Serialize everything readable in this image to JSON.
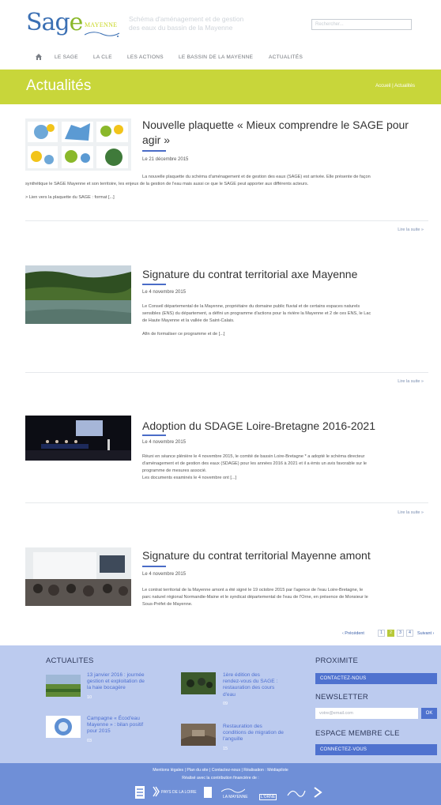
{
  "header": {
    "logo_main": "Sage",
    "logo_sub": "MAYENNE",
    "tagline_line1": "Schéma d'aménagement et de gestion",
    "tagline_line2": "des eaux du bassin de la Mayenne",
    "search_placeholder": "Rechercher..."
  },
  "nav": {
    "home_icon": "home-icon",
    "items": [
      "LE SAGE",
      "LA CLE",
      "LES ACTIONS",
      "LE BASSIN DE LA MAYENNE",
      "ACTUALITÉS"
    ]
  },
  "banner": {
    "title": "Actualités",
    "breadcrumb": "Accueil  |  Actualités"
  },
  "articles": [
    {
      "title_line1": "Nouvelle plaquette « Mieux comprendre le SAGE pour",
      "title_line2": "agir »",
      "date": "Le 21 décembre 2015",
      "text_line1": "La nouvelle plaquette du schéma d'aménagement et de gestion des eaux (SAGE) est arrivée. Elle présente de façon",
      "text_line2": "synthétique le SAGE Mayenne et son territoire, les enjeux de la gestion de l'eau mais aussi ce que le SAGE peut apporter aux différents acteurs.",
      "text_line3": "> Lien vers la plaquette du SAGE : format [...]",
      "readmore": "Lire la suite »"
    },
    {
      "title": "Signature du contrat territorial axe Mayenne",
      "date": "Le 4 novembre 2015",
      "text_line1": "Le Conseil départemental de la Mayenne, propriétaire du domaine public fluvial et de certains espaces naturels",
      "text_line2": "sensibles (ENS) du département, a défini un programme d'actions pour la rivière la Mayenne et 2 de ces ENS, le Lac",
      "text_line3": "de Haute Mayenne et la vallée de Saint-Calais.",
      "text_line4": "Afin de formaliser ce programme et de [...]",
      "readmore": "Lire la suite »"
    },
    {
      "title": "Adoption du SDAGE Loire-Bretagne 2016-2021",
      "date": "Le 4 novembre 2015",
      "text_line1": "Réuni en séance plénière le 4 novembre 2015, le comité de bassin Loire-Bretagne * a adopté le schéma directeur",
      "text_line2": "d'aménagement et de gestion des eaux (SDAGE) pour les années 2016 à 2021 et il a émis un avis favorable sur le",
      "text_line3": "programme de mesures associé.",
      "text_line4": "Les documents examinés le 4 novembre ont [...]",
      "readmore": "Lire la suite »"
    },
    {
      "title": "Signature du contrat territorial Mayenne amont",
      "date": "Le 4 novembre 2015",
      "text_line1": "Le contrat territorial de la Mayenne amont a été signé le 19 octobre 2015 par l'agence de l'eau Loire-Bretagne, le",
      "text_line2": "parc naturel régional Normandie-Maine et le syndicat départemental de l'eau de l'Orne, en présence de Monsieur le",
      "text_line3": "Sous-Préfet de Mayenne."
    }
  ],
  "pagination": {
    "prev": "‹ Précédent",
    "pages": [
      "1",
      "2",
      "3",
      "4"
    ],
    "active_page": "2",
    "next": "Suivant ›"
  },
  "footer": {
    "news_heading": "ACTUALITES",
    "news": [
      {
        "line1": "13 janvier 2016 : journée",
        "line2": "gestion et exploitation de",
        "line3": "la haie bocagère",
        "count": "10"
      },
      {
        "line1": "1ère édition des",
        "line2": "rendez-vous du SAGE :",
        "line3": "restauration des cours",
        "line4": "d'eau",
        "count": "09"
      },
      {
        "line1": "Campagne « Écod'eau",
        "line2": "Mayenne » : bilan positif",
        "line3": "pour 2015",
        "count": "03"
      },
      {
        "line1": "Restauration des",
        "line2": "conditions de migration de",
        "line3": "l'anguille",
        "count": "15"
      }
    ],
    "proximite_heading": "PROXIMITE",
    "contact_button": "CONTACTEZ-NOUS",
    "newsletter_heading": "NEWSLETTER",
    "email_placeholder": "votre@email.com",
    "ok_button": "OK",
    "membre_heading": "ESPACE MEMBRE CLE",
    "connect_button": "CONNECTEZ-VOUS",
    "links": "Mentions légales  |  Plan du site  |  Contactez-nous  |  Réalisation : Médiapilote",
    "funding": "Réalisé avec la contribution financière de :",
    "partners": [
      "PAYS DE LA LOIRE",
      "LA MAYENNE",
      "L'ORNE"
    ]
  },
  "colors": {
    "banner": "#c8d63a",
    "accent_blue": "#4a6cc7",
    "footer_bg": "#bccbef",
    "footer_bottom": "#6f8fd7"
  }
}
